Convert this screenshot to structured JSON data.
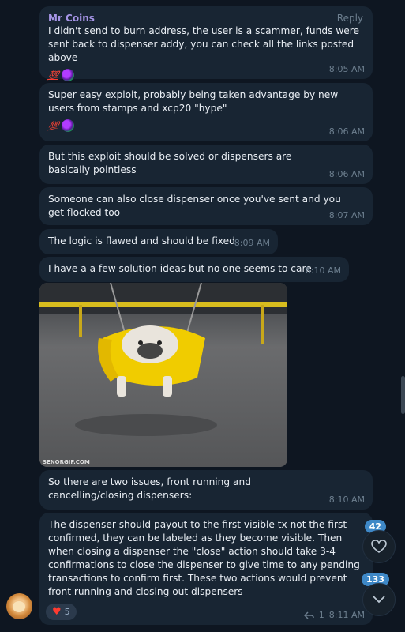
{
  "messages": [
    {
      "sender": "Mr Coins",
      "reply_label": "Reply",
      "text": "I didn't send to burn address, the user is a scammer, funds were sent back to dispenser addy, you can check all the links posted above",
      "reaction_hundred": "💯",
      "time": "8:05 AM"
    },
    {
      "text": "Super easy exploit, probably being taken advantage by new users from stamps and xcp20 \"hype\"",
      "reaction_hundred": "💯",
      "time": "8:06 AM"
    },
    {
      "text": "But this exploit should be solved or dispensers are basically pointless",
      "time": "8:06 AM"
    },
    {
      "text": "Someone can also close dispenser once you've sent and you get flocked too",
      "time": "8:07 AM"
    },
    {
      "text": "The logic is flawed and should be fixed",
      "time": "8:09 AM"
    },
    {
      "text": "I have a a few solution ideas but no one seems to care",
      "time": "8:10 AM"
    },
    {
      "media_watermark": "SENORGIF.COM"
    },
    {
      "text": "So there are two issues, front running and cancelling/closing dispensers:",
      "time": "8:10 AM"
    },
    {
      "text": "The dispenser should payout to the first visible tx not the first confirmed, they can be labeled as they become visible.  Then when closing a dispenser the \"close\" action should take 3-4 confirmations to close the dispenser to give time to any pending transactions to confirm first.  These two actions would prevent front running and closing out dispensers",
      "reaction_heart": "♥",
      "reaction_count": "5",
      "reply_count": "1",
      "time": "8:11 AM"
    }
  ],
  "side": {
    "mentions_badge": "42",
    "unread_badge": "133"
  },
  "colors": {
    "background": "#0e1621",
    "bubble": "#182533",
    "sender": "#a695e7",
    "time": "#6d7f8f",
    "badge": "#3e88c7",
    "heart": "#ff3b30"
  }
}
